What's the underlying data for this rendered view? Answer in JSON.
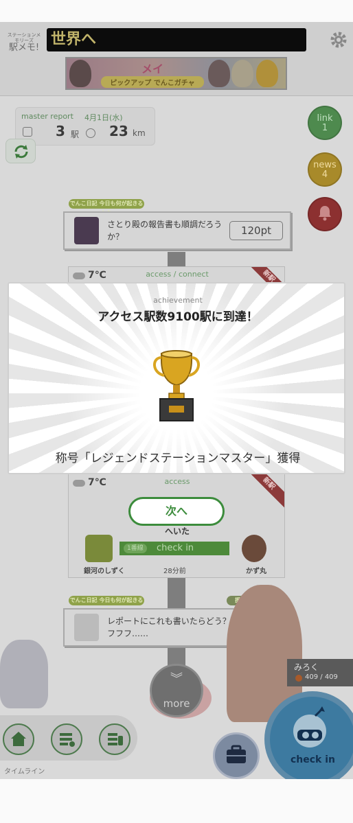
{
  "header": {
    "logo_text": "駅メモ!",
    "ticker_text": "世界へ",
    "banner": {
      "line1": "メイ",
      "line2": "ピックアップ でんこガチャ"
    }
  },
  "report": {
    "title": "master report",
    "date": "4月1日(水)",
    "stations_value": "3",
    "stations_unit": "駅",
    "distance_value": "23",
    "distance_unit": "km"
  },
  "side_buttons": {
    "link": {
      "label": "link",
      "count": "1"
    },
    "news": {
      "label": "news",
      "count": "4"
    }
  },
  "timeline": {
    "tag1": "でんこ日記 今日も何が起きるかな",
    "msg1": {
      "text": "さとり殿の報告書も順調だろうか？",
      "points": "120pt"
    },
    "station1": {
      "temp": "7℃",
      "access": "access / connect",
      "badge": "新駅"
    },
    "station2": {
      "temp": "7℃",
      "access": "access",
      "badge": "新駅",
      "name": "へいた",
      "check_tag": "1番線",
      "check_label": "check in",
      "left_user": "銀河のしずく",
      "right_user": "かず丸",
      "time": "28分前"
    },
    "tag2": "でんこ日記 今日も何が起きるかな",
    "tag2_badge": "援護",
    "msg2": {
      "text": "レポートにこれも書いたらどう？ フフフ……"
    }
  },
  "bottom": {
    "more_label": "more",
    "timeline_label": "タイムライン",
    "checkin_label": "check in",
    "player_name": "みろく",
    "player_hp": "409 / 409"
  },
  "modal": {
    "subtitle": "achievement",
    "title": "アクセス駅数9100駅に到達！",
    "footer": "称号「レジェンドステーションマスター」獲得",
    "next_button": "次へ"
  },
  "colors": {
    "accent_green": "#3c8c3c",
    "overlay_gray": "#d9d9d9",
    "new_badge": "#8c3a3a"
  },
  "icons": [
    "gear-icon",
    "refresh-icon",
    "bell-icon",
    "trophy-icon",
    "home-icon",
    "list-icon",
    "train-icon",
    "briefcase-icon",
    "cloud-icon",
    "chevron-down-icon"
  ]
}
